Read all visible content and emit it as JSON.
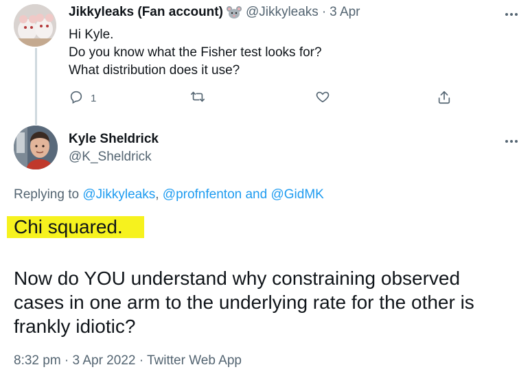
{
  "tweet1": {
    "author_name": "Jikkyleaks (Fan account)",
    "handle": "@Jikkyleaks",
    "separator": "·",
    "time": "3 Apr",
    "lines": [
      "Hi Kyle.",
      "Do you know what the Fisher test looks for?",
      "What distribution does it use?"
    ],
    "reply_count": "1",
    "icons": {
      "name_emoji": "mouse-icon",
      "reply": "reply-icon",
      "retweet": "retweet-icon",
      "like": "heart-icon",
      "share": "share-icon",
      "more": "more-icon"
    }
  },
  "tweet2": {
    "author_name": "Kyle Sheldrick",
    "handle": "@K_Sheldrick",
    "replying_prefix": "Replying to",
    "replying_user1": "@Jikkyleaks",
    "replying_comma": ",",
    "replying_user2": "@profnfenton",
    "replying_and": "and",
    "replying_user3": "@GidMK",
    "highlighted_text": "Chi squared.",
    "body_lines": [
      "Now do YOU understand why constraining observed",
      "cases in one arm to the underlying rate for the other is",
      "frankly idiotic?"
    ],
    "meta": "8:32 pm · 3 Apr 2022 · Twitter Web App"
  },
  "colors": {
    "text_primary": "#0f1419",
    "text_secondary": "#536471",
    "link": "#1d9bf0",
    "highlight": "#f6f21e",
    "thread_line": "#cfd9de"
  }
}
